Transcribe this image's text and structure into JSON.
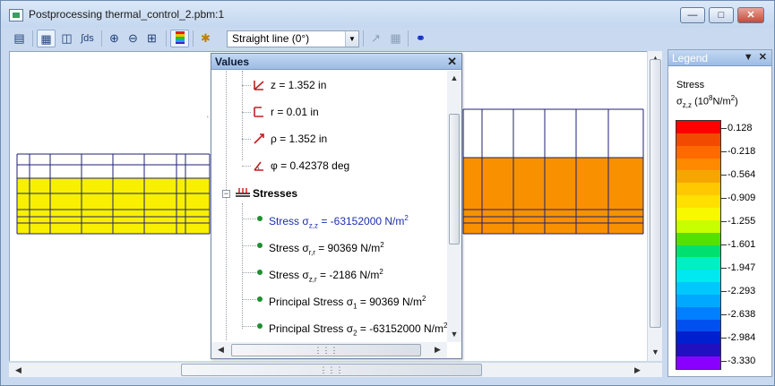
{
  "window": {
    "title": "Postprocessing thermal_control_2.pbm:1"
  },
  "toolbar": {
    "plot_type": "Straight line (0°)",
    "buttons": [
      "show-model",
      "data-table",
      "copy-values",
      "integral-ds",
      "zoom-in",
      "zoom-out",
      "zoom-extents",
      "color-legend",
      "marker",
      "chart",
      "grid-table",
      "curve"
    ]
  },
  "values_panel": {
    "title": "Values",
    "coords": [
      {
        "icon": "z-axis-icon",
        "text": "z = 1.352 in"
      },
      {
        "icon": "r-axis-icon",
        "text": "r = 0.01 in"
      },
      {
        "icon": "rho-axis-icon",
        "text": "ρ = 1.352 in"
      },
      {
        "icon": "phi-angle-icon",
        "text": "φ = 0.42378 deg"
      }
    ],
    "group_label": "Stresses",
    "stresses": [
      {
        "name": "Stress σ",
        "sub": "z,z",
        "value": " = -63152000 N/m",
        "sup": "2",
        "highlight": true
      },
      {
        "name": "Stress σ",
        "sub": "r,r",
        "value": " = 90369 N/m",
        "sup": "2",
        "highlight": false
      },
      {
        "name": "Stress σ",
        "sub": "z,r",
        "value": " = -2186 N/m",
        "sup": "2",
        "highlight": false
      },
      {
        "name": "Principal Stress σ",
        "sub": "1",
        "value": " = 90369 N/m",
        "sup": "2",
        "highlight": false
      },
      {
        "name": "Principal Stress σ",
        "sub": "2",
        "value": " = -63152000 N/m",
        "sup": "2",
        "highlight": false
      }
    ]
  },
  "legend": {
    "title": "Legend",
    "quantity": "Stress",
    "unit_symbol": "σ",
    "unit_sub": "z,z",
    "unit_text": " (10",
    "unit_exp": "8",
    "unit_tail": "N/m",
    "unit_tail_exp": "2",
    "unit_close": ")",
    "ticks": [
      "0.128",
      "-0.218",
      "-0.564",
      "-0.909",
      "-1.255",
      "-1.601",
      "-1.947",
      "-2.293",
      "-2.638",
      "-2.984",
      "-3.330"
    ],
    "colors": [
      "#ff0000",
      "#f24a00",
      "#ff6a00",
      "#ff8a00",
      "#f6a600",
      "#ffc800",
      "#ffe000",
      "#f8f800",
      "#c8ff00",
      "#55e000",
      "#00e070",
      "#00f0c0",
      "#00e8f0",
      "#00c8ff",
      "#00a8ff",
      "#0080ff",
      "#0050f0",
      "#0020d0",
      "#2010c0",
      "#8a00ff"
    ]
  },
  "canvas": {
    "left_fill": "#f8f000",
    "right_fill": "#f89000",
    "mesh_line": "#1f1f7a"
  }
}
